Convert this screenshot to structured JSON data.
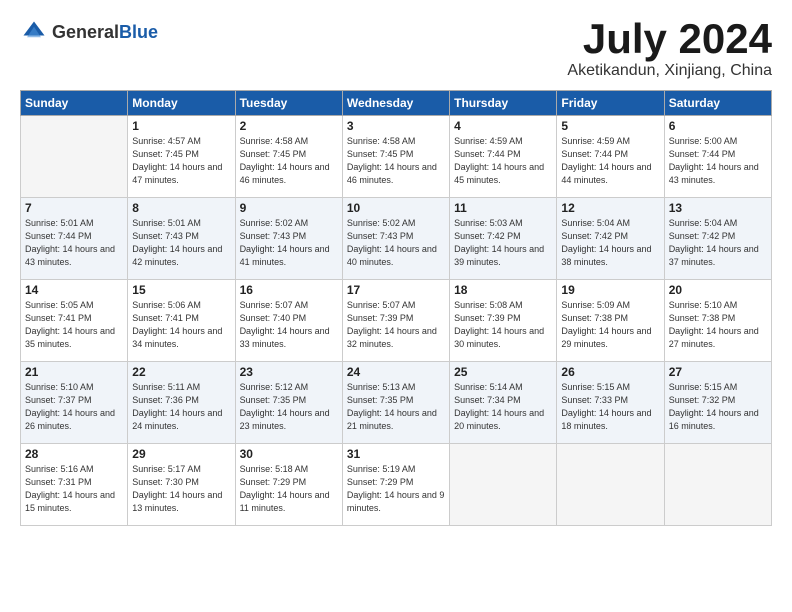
{
  "logo": {
    "general": "General",
    "blue": "Blue"
  },
  "title": {
    "month_year": "July 2024",
    "location": "Aketikandun, Xinjiang, China"
  },
  "weekdays": [
    "Sunday",
    "Monday",
    "Tuesday",
    "Wednesday",
    "Thursday",
    "Friday",
    "Saturday"
  ],
  "weeks": [
    [
      {
        "day": "",
        "empty": true
      },
      {
        "day": "1",
        "sunrise": "Sunrise: 4:57 AM",
        "sunset": "Sunset: 7:45 PM",
        "daylight": "Daylight: 14 hours and 47 minutes."
      },
      {
        "day": "2",
        "sunrise": "Sunrise: 4:58 AM",
        "sunset": "Sunset: 7:45 PM",
        "daylight": "Daylight: 14 hours and 46 minutes."
      },
      {
        "day": "3",
        "sunrise": "Sunrise: 4:58 AM",
        "sunset": "Sunset: 7:45 PM",
        "daylight": "Daylight: 14 hours and 46 minutes."
      },
      {
        "day": "4",
        "sunrise": "Sunrise: 4:59 AM",
        "sunset": "Sunset: 7:44 PM",
        "daylight": "Daylight: 14 hours and 45 minutes."
      },
      {
        "day": "5",
        "sunrise": "Sunrise: 4:59 AM",
        "sunset": "Sunset: 7:44 PM",
        "daylight": "Daylight: 14 hours and 44 minutes."
      },
      {
        "day": "6",
        "sunrise": "Sunrise: 5:00 AM",
        "sunset": "Sunset: 7:44 PM",
        "daylight": "Daylight: 14 hours and 43 minutes."
      }
    ],
    [
      {
        "day": "7",
        "sunrise": "Sunrise: 5:01 AM",
        "sunset": "Sunset: 7:44 PM",
        "daylight": "Daylight: 14 hours and 43 minutes."
      },
      {
        "day": "8",
        "sunrise": "Sunrise: 5:01 AM",
        "sunset": "Sunset: 7:43 PM",
        "daylight": "Daylight: 14 hours and 42 minutes."
      },
      {
        "day": "9",
        "sunrise": "Sunrise: 5:02 AM",
        "sunset": "Sunset: 7:43 PM",
        "daylight": "Daylight: 14 hours and 41 minutes."
      },
      {
        "day": "10",
        "sunrise": "Sunrise: 5:02 AM",
        "sunset": "Sunset: 7:43 PM",
        "daylight": "Daylight: 14 hours and 40 minutes."
      },
      {
        "day": "11",
        "sunrise": "Sunrise: 5:03 AM",
        "sunset": "Sunset: 7:42 PM",
        "daylight": "Daylight: 14 hours and 39 minutes."
      },
      {
        "day": "12",
        "sunrise": "Sunrise: 5:04 AM",
        "sunset": "Sunset: 7:42 PM",
        "daylight": "Daylight: 14 hours and 38 minutes."
      },
      {
        "day": "13",
        "sunrise": "Sunrise: 5:04 AM",
        "sunset": "Sunset: 7:42 PM",
        "daylight": "Daylight: 14 hours and 37 minutes."
      }
    ],
    [
      {
        "day": "14",
        "sunrise": "Sunrise: 5:05 AM",
        "sunset": "Sunset: 7:41 PM",
        "daylight": "Daylight: 14 hours and 35 minutes."
      },
      {
        "day": "15",
        "sunrise": "Sunrise: 5:06 AM",
        "sunset": "Sunset: 7:41 PM",
        "daylight": "Daylight: 14 hours and 34 minutes."
      },
      {
        "day": "16",
        "sunrise": "Sunrise: 5:07 AM",
        "sunset": "Sunset: 7:40 PM",
        "daylight": "Daylight: 14 hours and 33 minutes."
      },
      {
        "day": "17",
        "sunrise": "Sunrise: 5:07 AM",
        "sunset": "Sunset: 7:39 PM",
        "daylight": "Daylight: 14 hours and 32 minutes."
      },
      {
        "day": "18",
        "sunrise": "Sunrise: 5:08 AM",
        "sunset": "Sunset: 7:39 PM",
        "daylight": "Daylight: 14 hours and 30 minutes."
      },
      {
        "day": "19",
        "sunrise": "Sunrise: 5:09 AM",
        "sunset": "Sunset: 7:38 PM",
        "daylight": "Daylight: 14 hours and 29 minutes."
      },
      {
        "day": "20",
        "sunrise": "Sunrise: 5:10 AM",
        "sunset": "Sunset: 7:38 PM",
        "daylight": "Daylight: 14 hours and 27 minutes."
      }
    ],
    [
      {
        "day": "21",
        "sunrise": "Sunrise: 5:10 AM",
        "sunset": "Sunset: 7:37 PM",
        "daylight": "Daylight: 14 hours and 26 minutes."
      },
      {
        "day": "22",
        "sunrise": "Sunrise: 5:11 AM",
        "sunset": "Sunset: 7:36 PM",
        "daylight": "Daylight: 14 hours and 24 minutes."
      },
      {
        "day": "23",
        "sunrise": "Sunrise: 5:12 AM",
        "sunset": "Sunset: 7:35 PM",
        "daylight": "Daylight: 14 hours and 23 minutes."
      },
      {
        "day": "24",
        "sunrise": "Sunrise: 5:13 AM",
        "sunset": "Sunset: 7:35 PM",
        "daylight": "Daylight: 14 hours and 21 minutes."
      },
      {
        "day": "25",
        "sunrise": "Sunrise: 5:14 AM",
        "sunset": "Sunset: 7:34 PM",
        "daylight": "Daylight: 14 hours and 20 minutes."
      },
      {
        "day": "26",
        "sunrise": "Sunrise: 5:15 AM",
        "sunset": "Sunset: 7:33 PM",
        "daylight": "Daylight: 14 hours and 18 minutes."
      },
      {
        "day": "27",
        "sunrise": "Sunrise: 5:15 AM",
        "sunset": "Sunset: 7:32 PM",
        "daylight": "Daylight: 14 hours and 16 minutes."
      }
    ],
    [
      {
        "day": "28",
        "sunrise": "Sunrise: 5:16 AM",
        "sunset": "Sunset: 7:31 PM",
        "daylight": "Daylight: 14 hours and 15 minutes."
      },
      {
        "day": "29",
        "sunrise": "Sunrise: 5:17 AM",
        "sunset": "Sunset: 7:30 PM",
        "daylight": "Daylight: 14 hours and 13 minutes."
      },
      {
        "day": "30",
        "sunrise": "Sunrise: 5:18 AM",
        "sunset": "Sunset: 7:29 PM",
        "daylight": "Daylight: 14 hours and 11 minutes."
      },
      {
        "day": "31",
        "sunrise": "Sunrise: 5:19 AM",
        "sunset": "Sunset: 7:29 PM",
        "daylight": "Daylight: 14 hours and 9 minutes."
      },
      {
        "day": "",
        "empty": true
      },
      {
        "day": "",
        "empty": true
      },
      {
        "day": "",
        "empty": true
      }
    ]
  ]
}
